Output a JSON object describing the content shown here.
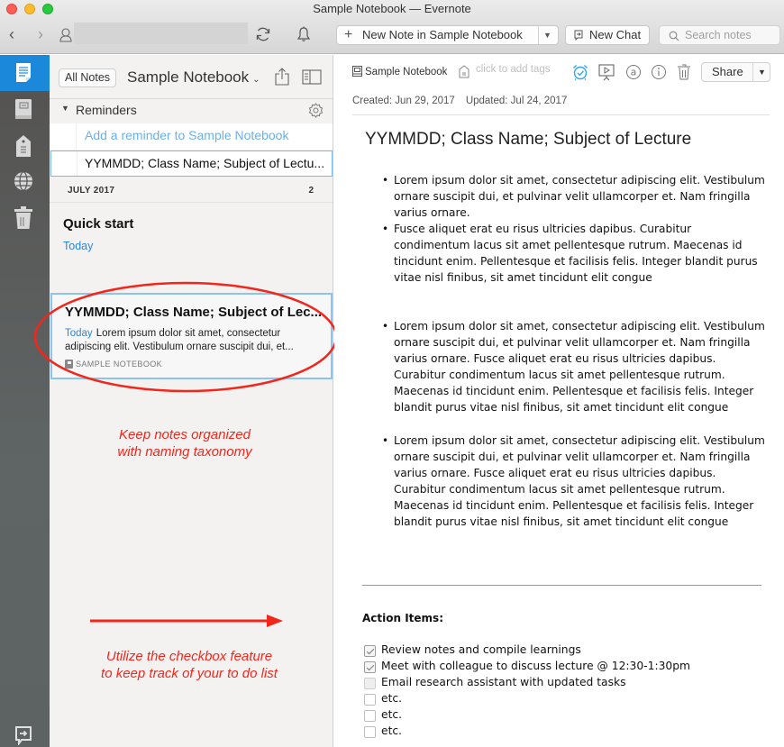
{
  "window": {
    "title": "Sample Notebook — Evernote"
  },
  "toolbar": {
    "new_note_label": "New Note in Sample Notebook",
    "new_chat_label": "New Chat",
    "search_placeholder": "Search notes"
  },
  "sidebar": {
    "items": [
      {
        "name": "notes",
        "icon": "note-icon",
        "active": true
      },
      {
        "name": "notebooks",
        "icon": "notebook-icon",
        "active": false
      },
      {
        "name": "tags",
        "icon": "tag-icon",
        "active": false
      },
      {
        "name": "work-chat",
        "icon": "globe-icon",
        "active": false
      },
      {
        "name": "trash",
        "icon": "trash-icon",
        "active": false
      }
    ],
    "bottom_icon": "switch-account-icon"
  },
  "note_list": {
    "all_notes_label": "All Notes",
    "notebook_title": "Sample Notebook",
    "reminders_label": "Reminders",
    "add_reminder_label": "Add a reminder to Sample Notebook",
    "reminder_item": "YYMMDD; Class Name; Subject of Lectu...",
    "month_label": "JULY 2017",
    "month_count": "2",
    "notes": [
      {
        "title": "Quick start",
        "date": "Today"
      },
      {
        "title": "YYMMDD; Class Name; Subject of Lec...",
        "date": "Today",
        "snippet": "Lorem ipsum dolor sit amet, consectetur adipiscing elit. Vestibulum ornare suscipit dui, et...",
        "notebook": "SAMPLE NOTEBOOK"
      }
    ]
  },
  "annotations": {
    "naming": [
      "Keep notes organized",
      "with naming taxonomy"
    ],
    "checkbox": [
      "Utilize the checkbox feature",
      "to keep track of your to do list"
    ],
    "color": "#f3261c"
  },
  "editor": {
    "notebook_label": "Sample Notebook",
    "tags_placeholder": "click to add tags",
    "share_label": "Share",
    "created": "Created: Jun 29, 2017",
    "updated": "Updated: Jul 24, 2017",
    "title": "YYMMDD; Class Name; Subject of Lecture",
    "bullets_group1": [
      "Lorem ipsum dolor sit amet, consectetur adipiscing elit. Vestibulum ornare suscipit dui, et pulvinar velit ullamcorper et. Nam fringilla varius ornare.",
      "Fusce aliquet erat eu risus ultricies dapibus. Curabitur condimentum lacus sit amet pellentesque rutrum. Maecenas id tincidunt enim. Pellentesque et facilisis felis. Integer blandit purus vitae nisl finibus, sit amet tincidunt elit congue"
    ],
    "bullets_group2": [
      "Lorem ipsum dolor sit amet, consectetur adipiscing elit. Vestibulum ornare suscipit dui, et pulvinar velit ullamcorper et. Nam fringilla varius ornare. Fusce aliquet erat eu risus ultricies dapibus. Curabitur condimentum lacus sit amet pellentesque rutrum. Maecenas id tincidunt enim. Pellentesque et facilisis felis. Integer blandit purus vitae nisl finibus, sit amet tincidunt elit congue"
    ],
    "bullets_group3": [
      "Lorem ipsum dolor sit amet, consectetur adipiscing elit. Vestibulum ornare suscipit dui, et pulvinar velit ullamcorper et. Nam fringilla varius ornare. Fusce aliquet erat eu risus ultricies dapibus. Curabitur condimentum lacus sit amet pellentesque rutrum. Maecenas id tincidunt enim. Pellentesque et facilisis felis. Integer blandit purus vitae nisl finibus, sit amet tincidunt elit congue"
    ],
    "action_items_heading": "Action Items:",
    "action_items": [
      {
        "text": "Review notes and compile learnings",
        "checked": true
      },
      {
        "text": "Meet with colleague to discuss lecture @ 12:30-1:30pm",
        "checked": true
      },
      {
        "text": "Email research assistant with updated tasks",
        "checked": false
      },
      {
        "text": "etc.",
        "checked": false
      },
      {
        "text": "etc.",
        "checked": false
      },
      {
        "text": "etc.",
        "checked": false
      }
    ]
  },
  "colors": {
    "accent": "#1b88d9",
    "link_blue": "#2b87d9",
    "reminder_icon": "#2fa5f0"
  }
}
